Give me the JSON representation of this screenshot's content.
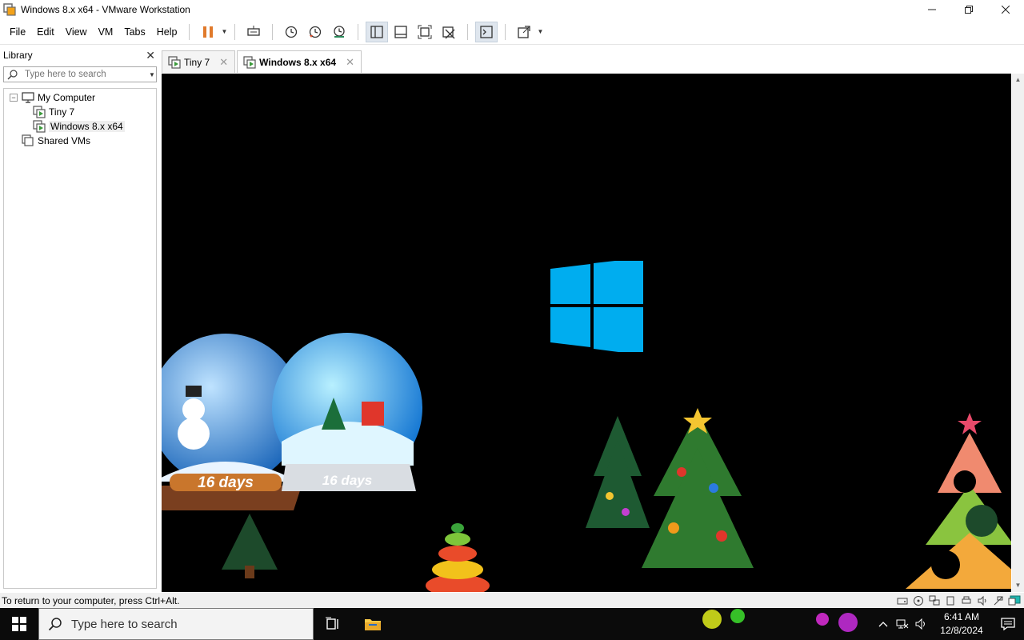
{
  "window": {
    "title": "Windows 8.x x64 - VMware Workstation"
  },
  "menu": {
    "items": [
      "File",
      "Edit",
      "View",
      "VM",
      "Tabs",
      "Help"
    ]
  },
  "library": {
    "title": "Library",
    "search_placeholder": "Type here to search",
    "tree": [
      {
        "label": "My Computer",
        "level": 0
      },
      {
        "label": "Tiny 7",
        "level": 1
      },
      {
        "label": "Windows 8.x x64",
        "level": 1
      },
      {
        "label": "Shared VMs",
        "level": 0
      }
    ]
  },
  "tabs": [
    {
      "label": "Tiny 7",
      "active": false
    },
    {
      "label": "Windows 8.x x64",
      "active": true
    }
  ],
  "desktop": {
    "globe_left_label": "16 days",
    "globe_right_label": "16 days"
  },
  "statusbar": {
    "message": "To return to your computer, press Ctrl+Alt."
  },
  "taskbar": {
    "search_placeholder": "Type here to search",
    "time": "6:41 AM",
    "date": "12/8/2024"
  },
  "colors": {
    "windows_logo": "#00adef",
    "vm_background": "#000000",
    "taskbar": "#0b0b0b",
    "pause_orange": "#e07a2b"
  }
}
